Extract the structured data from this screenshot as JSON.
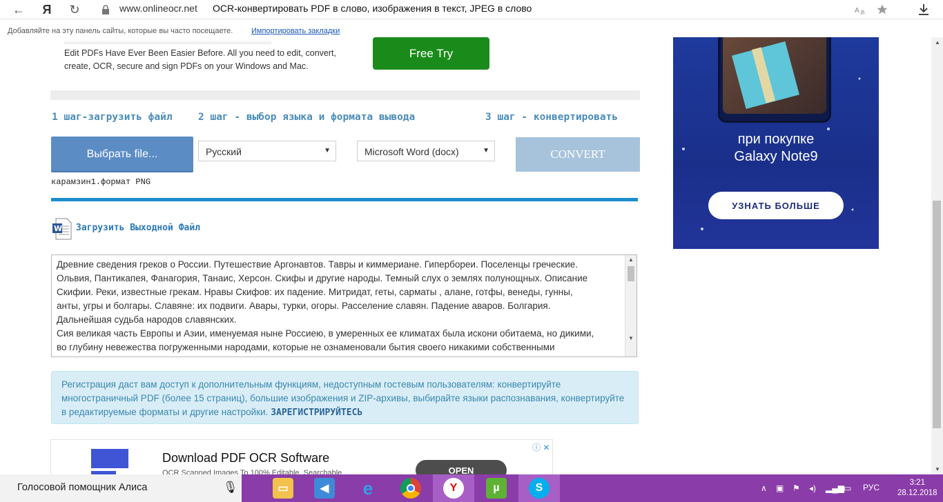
{
  "browser": {
    "back_icon": "←",
    "yandex_logo": "Я",
    "reload_icon": "↻",
    "domain": "www.onlineocr.net",
    "title": "OCR-конвертировать PDF в слово, изображения в текст, JPEG в слово",
    "bookmarks_text": "Добавляйте на эту панель сайты, которые вы часто посещаете.",
    "bookmarks_link": "Импортировать закладки"
  },
  "promo": {
    "text": "Edit PDFs Have Ever Been Easier Before. All you need to edit, convert, create, OCR, secure and sign PDFs on your Windows and Mac.",
    "free_try": "Free Try"
  },
  "steps": {
    "step1": "1 шаг-загрузить файл",
    "step2": "2 шаг - выбор языка и формата вывода",
    "step3": "3 шаг - конвертировать"
  },
  "controls": {
    "choose_file": "Выбрать file...",
    "language": "Русский",
    "format": "Microsoft Word (docx)",
    "convert": "CONVERT",
    "filename": "карамзин1.формат PNG"
  },
  "download": {
    "label": "Загрузить Выходной Файл"
  },
  "output_text": "Древние сведения греков о России. Путешествие Аргонавтов. Тавры и киммериане. Гипербореи. Поселенцы греческие.\nОльвия, Пантикапея, Фанагория, Танаис, Херсон. Скифы и другие народы. Темный слух о землях полунощных. Описание\nСкифии. Реки, известные грекам. Нравы Скифов: их падение. Митридат, геты, сарматы , алане, готфы, венеды, гунны,\nанты, угры и болгары. Славяне: их подвиги. Авары, турки, огоры. Расселение славян. Падение аваров. Болгария.\nДальнейшая судьба народов славянских.\nСия великая часть Европы и Азии, именуемая ныне Россиею, в умеренных ее климатах была искони обитаема, но дикими,\nво глубину невежества погруженными народами, которые не ознаменовали бытия своего никакими собственными",
  "registration": {
    "text": "Регистрация даст вам доступ к дополнительным функциям, недоступным гостевым пользователям: конвертируйте многостраничный PDF (более 15 страниц), большие изображения и ZIP-архивы, выбирайте языки распознавания, конвертируйте в редактируемые форматы и другие настройки.",
    "link": "ЗАРЕГИСТРИРУЙТЕСЬ"
  },
  "ad_bottom": {
    "title": "Download PDF OCR Software",
    "subtitle": "OCR Scanned Images To 100% Editable, Searchable",
    "open": "OPEN",
    "info": "ⓘ ✕"
  },
  "ad_right": {
    "text_line1": "при покупке",
    "text_line2": "Galaxy Note9",
    "button": "УЗНАТЬ БОЛЬШЕ"
  },
  "taskbar": {
    "search_text": "Голосовой помощник Алиса",
    "lang": "РУС",
    "time": "3:21",
    "date": "28.12.2018"
  }
}
